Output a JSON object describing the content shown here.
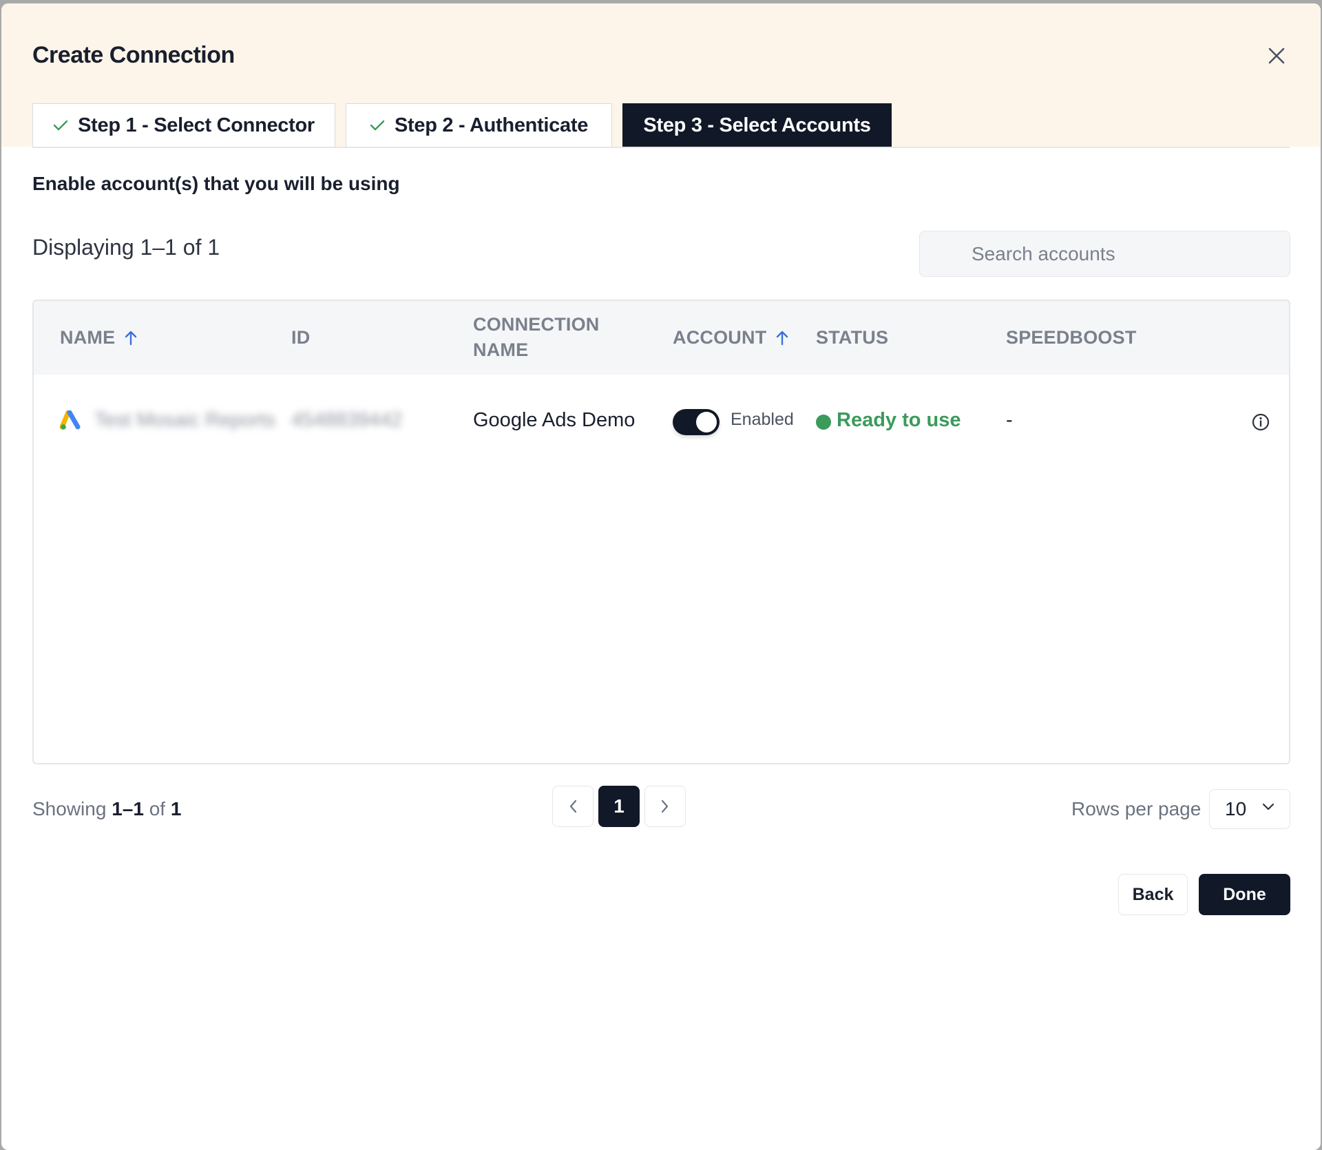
{
  "dialog": {
    "title": "Create Connection"
  },
  "tabs": [
    {
      "label": "Step 1 - Select Connector",
      "completed": true
    },
    {
      "label": "Step 2 - Authenticate",
      "completed": true
    },
    {
      "label": "Step 3 - Select Accounts",
      "active": true
    }
  ],
  "subtitle": "Enable account(s) that you will be using",
  "displaying": "Displaying 1–1 of 1",
  "search": {
    "placeholder": "Search accounts"
  },
  "table": {
    "headers": {
      "name": "NAME",
      "id": "ID",
      "connection_name_1": "CONNECTION",
      "connection_name_2": "NAME",
      "account": "ACCOUNT",
      "status": "STATUS",
      "speedboost": "SPEEDBOOST"
    },
    "rows": [
      {
        "name": "Test Mosaic Reports",
        "id": "4548839442",
        "connection_name": "Google Ads Demo",
        "account_toggle": "Enabled",
        "status": "Ready to use",
        "speedboost": "-"
      }
    ]
  },
  "footer": {
    "showing_prefix": "Showing",
    "showing_range": "1–1",
    "showing_of": "of",
    "showing_total": "1",
    "current_page": "1",
    "rows_per_page_label": "Rows per page",
    "rows_per_page_value": "10"
  },
  "actions": {
    "back": "Back",
    "done": "Done"
  },
  "colors": {
    "dark": "#111827",
    "header_bg": "#fdf5ea",
    "status_green": "#3a9b5b",
    "sort_arrow_blue": "#3b6fd9"
  }
}
